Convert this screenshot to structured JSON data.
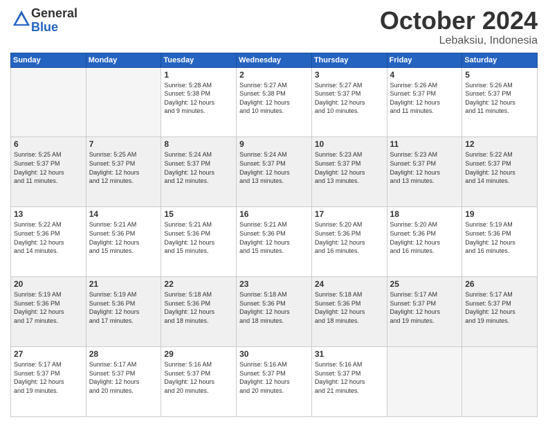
{
  "logo": {
    "general": "General",
    "blue": "Blue"
  },
  "header": {
    "month": "October 2024",
    "location": "Lebaksiu, Indonesia"
  },
  "weekdays": [
    "Sunday",
    "Monday",
    "Tuesday",
    "Wednesday",
    "Thursday",
    "Friday",
    "Saturday"
  ],
  "days": [
    {
      "date": null,
      "sunrise": null,
      "sunset": null,
      "daylight": null
    },
    {
      "date": null,
      "sunrise": null,
      "sunset": null,
      "daylight": null
    },
    {
      "date": "1",
      "sunrise": "5:28 AM",
      "sunset": "5:38 PM",
      "daylight": "12 hours and 9 minutes."
    },
    {
      "date": "2",
      "sunrise": "5:27 AM",
      "sunset": "5:38 PM",
      "daylight": "12 hours and 10 minutes."
    },
    {
      "date": "3",
      "sunrise": "5:27 AM",
      "sunset": "5:37 PM",
      "daylight": "12 hours and 10 minutes."
    },
    {
      "date": "4",
      "sunrise": "5:26 AM",
      "sunset": "5:37 PM",
      "daylight": "12 hours and 11 minutes."
    },
    {
      "date": "5",
      "sunrise": "5:26 AM",
      "sunset": "5:37 PM",
      "daylight": "12 hours and 11 minutes."
    },
    {
      "date": "6",
      "sunrise": "5:25 AM",
      "sunset": "5:37 PM",
      "daylight": "12 hours and 11 minutes."
    },
    {
      "date": "7",
      "sunrise": "5:25 AM",
      "sunset": "5:37 PM",
      "daylight": "12 hours and 12 minutes."
    },
    {
      "date": "8",
      "sunrise": "5:24 AM",
      "sunset": "5:37 PM",
      "daylight": "12 hours and 12 minutes."
    },
    {
      "date": "9",
      "sunrise": "5:24 AM",
      "sunset": "5:37 PM",
      "daylight": "12 hours and 13 minutes."
    },
    {
      "date": "10",
      "sunrise": "5:23 AM",
      "sunset": "5:37 PM",
      "daylight": "12 hours and 13 minutes."
    },
    {
      "date": "11",
      "sunrise": "5:23 AM",
      "sunset": "5:37 PM",
      "daylight": "12 hours and 13 minutes."
    },
    {
      "date": "12",
      "sunrise": "5:22 AM",
      "sunset": "5:37 PM",
      "daylight": "12 hours and 14 minutes."
    },
    {
      "date": "13",
      "sunrise": "5:22 AM",
      "sunset": "5:36 PM",
      "daylight": "12 hours and 14 minutes."
    },
    {
      "date": "14",
      "sunrise": "5:21 AM",
      "sunset": "5:36 PM",
      "daylight": "12 hours and 15 minutes."
    },
    {
      "date": "15",
      "sunrise": "5:21 AM",
      "sunset": "5:36 PM",
      "daylight": "12 hours and 15 minutes."
    },
    {
      "date": "16",
      "sunrise": "5:21 AM",
      "sunset": "5:36 PM",
      "daylight": "12 hours and 15 minutes."
    },
    {
      "date": "17",
      "sunrise": "5:20 AM",
      "sunset": "5:36 PM",
      "daylight": "12 hours and 16 minutes."
    },
    {
      "date": "18",
      "sunrise": "5:20 AM",
      "sunset": "5:36 PM",
      "daylight": "12 hours and 16 minutes."
    },
    {
      "date": "19",
      "sunrise": "5:19 AM",
      "sunset": "5:36 PM",
      "daylight": "12 hours and 16 minutes."
    },
    {
      "date": "20",
      "sunrise": "5:19 AM",
      "sunset": "5:36 PM",
      "daylight": "12 hours and 17 minutes."
    },
    {
      "date": "21",
      "sunrise": "5:19 AM",
      "sunset": "5:36 PM",
      "daylight": "12 hours and 17 minutes."
    },
    {
      "date": "22",
      "sunrise": "5:18 AM",
      "sunset": "5:36 PM",
      "daylight": "12 hours and 18 minutes."
    },
    {
      "date": "23",
      "sunrise": "5:18 AM",
      "sunset": "5:36 PM",
      "daylight": "12 hours and 18 minutes."
    },
    {
      "date": "24",
      "sunrise": "5:18 AM",
      "sunset": "5:36 PM",
      "daylight": "12 hours and 18 minutes."
    },
    {
      "date": "25",
      "sunrise": "5:17 AM",
      "sunset": "5:37 PM",
      "daylight": "12 hours and 19 minutes."
    },
    {
      "date": "26",
      "sunrise": "5:17 AM",
      "sunset": "5:37 PM",
      "daylight": "12 hours and 19 minutes."
    },
    {
      "date": "27",
      "sunrise": "5:17 AM",
      "sunset": "5:37 PM",
      "daylight": "12 hours and 19 minutes."
    },
    {
      "date": "28",
      "sunrise": "5:17 AM",
      "sunset": "5:37 PM",
      "daylight": "12 hours and 20 minutes."
    },
    {
      "date": "29",
      "sunrise": "5:16 AM",
      "sunset": "5:37 PM",
      "daylight": "12 hours and 20 minutes."
    },
    {
      "date": "30",
      "sunrise": "5:16 AM",
      "sunset": "5:37 PM",
      "daylight": "12 hours and 20 minutes."
    },
    {
      "date": "31",
      "sunrise": "5:16 AM",
      "sunset": "5:37 PM",
      "daylight": "12 hours and 21 minutes."
    },
    {
      "date": null,
      "sunrise": null,
      "sunset": null,
      "daylight": null
    },
    {
      "date": null,
      "sunrise": null,
      "sunset": null,
      "daylight": null
    }
  ],
  "labels": {
    "sunrise": "Sunrise:",
    "sunset": "Sunset:",
    "daylight": "Daylight:"
  }
}
